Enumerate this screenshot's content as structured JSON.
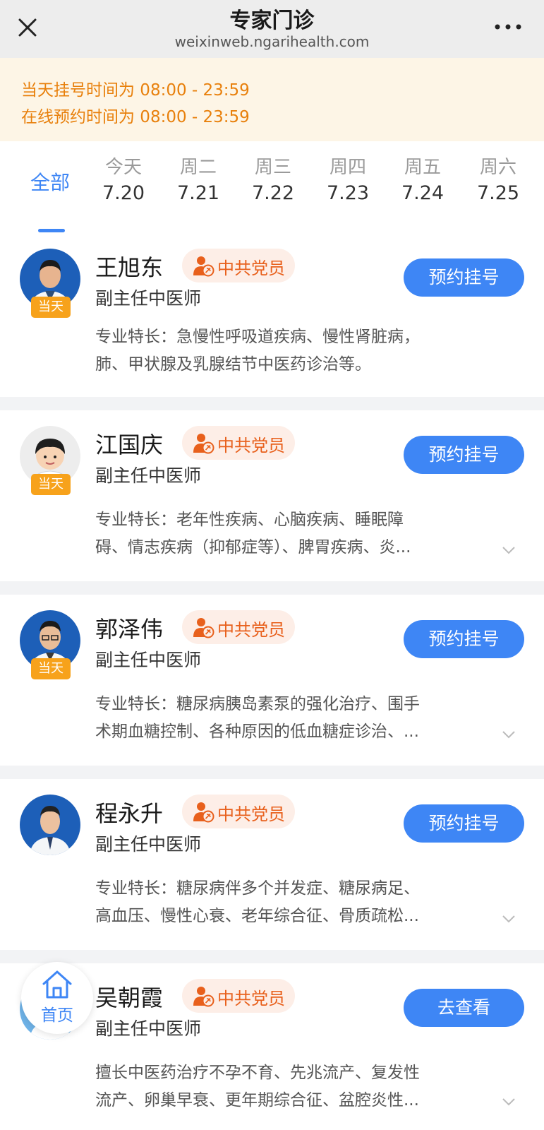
{
  "header": {
    "title": "专家门诊",
    "url": "weixinweb.ngarihealth.com",
    "close_icon": "close-icon",
    "more_icon": "more-icon"
  },
  "notice": {
    "line1": "当天挂号时间为 08:00 - 23:59",
    "line2": "在线预约时间为 08:00 - 23:59"
  },
  "tabs": {
    "all": "全部",
    "days": [
      {
        "weekday": "今天",
        "date": "7.20"
      },
      {
        "weekday": "周二",
        "date": "7.21"
      },
      {
        "weekday": "周三",
        "date": "7.22"
      },
      {
        "weekday": "周四",
        "date": "7.23"
      },
      {
        "weekday": "周五",
        "date": "7.24"
      },
      {
        "weekday": "周六",
        "date": "7.25"
      }
    ]
  },
  "colors": {
    "accent": "#3e86f5",
    "notice_text": "#e8800c",
    "badge": "#f7a21b",
    "party": "#e8601c"
  },
  "doctors": [
    {
      "name": "王旭东",
      "party": "中共党员",
      "rank": "副主任中医师",
      "badge": "当天",
      "button": "预约挂号",
      "specialty_lines": [
        "专业特长：急慢性呼吸道疾病、慢性肾脏病，",
        "肺、甲状腺及乳腺结节中医药诊治等。"
      ]
    },
    {
      "name": "江国庆",
      "party": "中共党员",
      "rank": "副主任中医师",
      "badge": "当天",
      "button": "预约挂号",
      "specialty_lines": [
        "专业特长：老年性疾病、心脑疾病、睡眠障",
        "碍、情志疾病（抑郁症等）、脾胃疾病、炎..."
      ]
    },
    {
      "name": "郭泽伟",
      "party": "中共党员",
      "rank": "副主任中医师",
      "badge": "当天",
      "button": "预约挂号",
      "specialty_lines": [
        "专业特长：糖尿病胰岛素泵的强化治疗、围手",
        "术期血糖控制、各种原因的低血糖症诊治、..."
      ]
    },
    {
      "name": "程永升",
      "party": "中共党员",
      "rank": "副主任中医师",
      "button": "预约挂号",
      "specialty_lines": [
        "专业特长：糖尿病伴多个并发症、糖尿病足、",
        "高血压、慢性心衰、老年综合征、骨质疏松..."
      ]
    },
    {
      "name": "吴朝霞",
      "party": "中共党员",
      "rank": "副主任中医师",
      "button": "去查看",
      "specialty_lines": [
        "擅长中医药治疗不孕不育、先兆流产、复发性",
        "流产、卵巢早衰、更年期综合征、盆腔炎性..."
      ]
    }
  ],
  "home": {
    "label": "首页",
    "icon": "home-icon"
  }
}
